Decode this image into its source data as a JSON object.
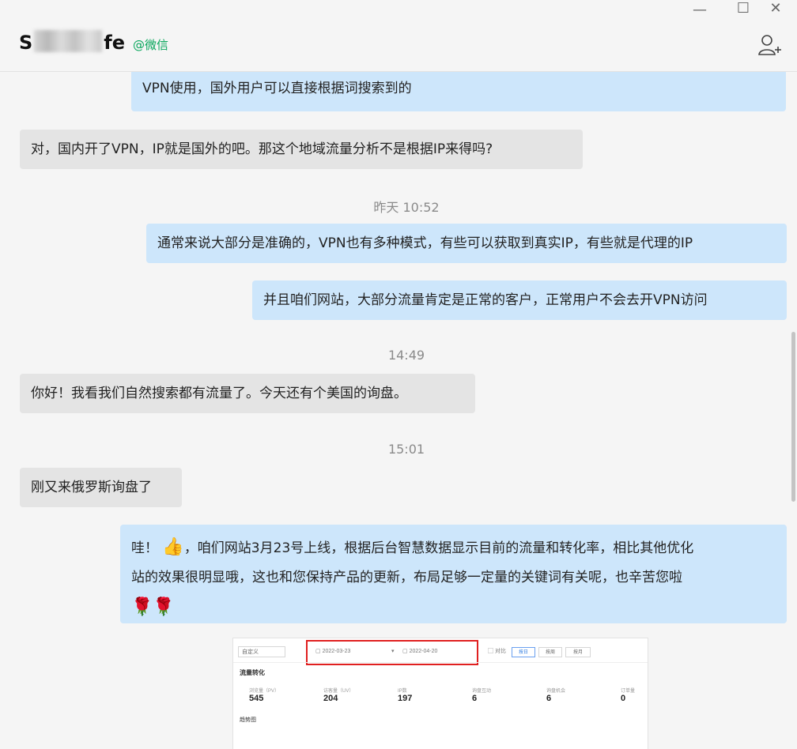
{
  "header": {
    "title_visible_start": "S",
    "title_visible_end": "fe",
    "badge": "@微信"
  },
  "messages": {
    "m0": "VPN使用，国外用户可以直接根据词搜索到的",
    "m1": "对，国内开了VPN，IP就是国外的吧。那这个地域流量分析不是根据IP来得吗?",
    "ts1": "昨天 10:52",
    "m2": "通常来说大部分是准确的，VPN也有多种模式，有些可以获取到真实IP，有些就是代理的IP",
    "m3": "并且咱们网站，大部分流量肯定是正常的客户，正常用户不会去开VPN访问",
    "ts2": "14:49",
    "m4": "你好！我看我们自然搜索都有流量了。今天还有个美国的询盘。",
    "ts3": "15:01",
    "m5": "刚又来俄罗斯询盘了",
    "m6_line1_a": "哇！",
    "m6_line1_b": "，咱们网站3月23号上线，根据后台智慧数据显示目前的流量和转化率，相比其他优化",
    "m6_line2": "站的效果很明显哦，这也和您保持产品的更新，布局足够一定量的关键词有关呢，也辛苦您啦",
    "m6_emojis": "🌹🌹"
  },
  "screenshot": {
    "select_label": "自定义",
    "date_start": "2022-03-23",
    "date_end": "2022-04-20",
    "compare_label": "对比",
    "tabs": [
      "按日",
      "按周",
      "按月"
    ],
    "section_title": "流量转化",
    "stats": [
      {
        "label": "浏览量（PV）",
        "value": "545"
      },
      {
        "label": "访客量（UV）",
        "value": "204"
      },
      {
        "label": "IP数",
        "value": "197"
      },
      {
        "label": "询盘互动",
        "value": "6"
      },
      {
        "label": "询盘机会",
        "value": "6"
      },
      {
        "label": "订单量",
        "value": "0"
      }
    ],
    "section_title2": "趋势图"
  },
  "icons": {
    "minimize": "minimize-icon",
    "maximize": "maximize-icon",
    "close": "close-icon",
    "add_contact": "add-contact-icon",
    "thumbs_up": "thumbs-up-emoji",
    "rose": "rose-emoji"
  },
  "colors": {
    "incoming_bubble": "#e4e4e4",
    "outgoing_bubble": "#cde6fb",
    "badge_green": "#07a65b",
    "highlight_red": "#e02020"
  }
}
